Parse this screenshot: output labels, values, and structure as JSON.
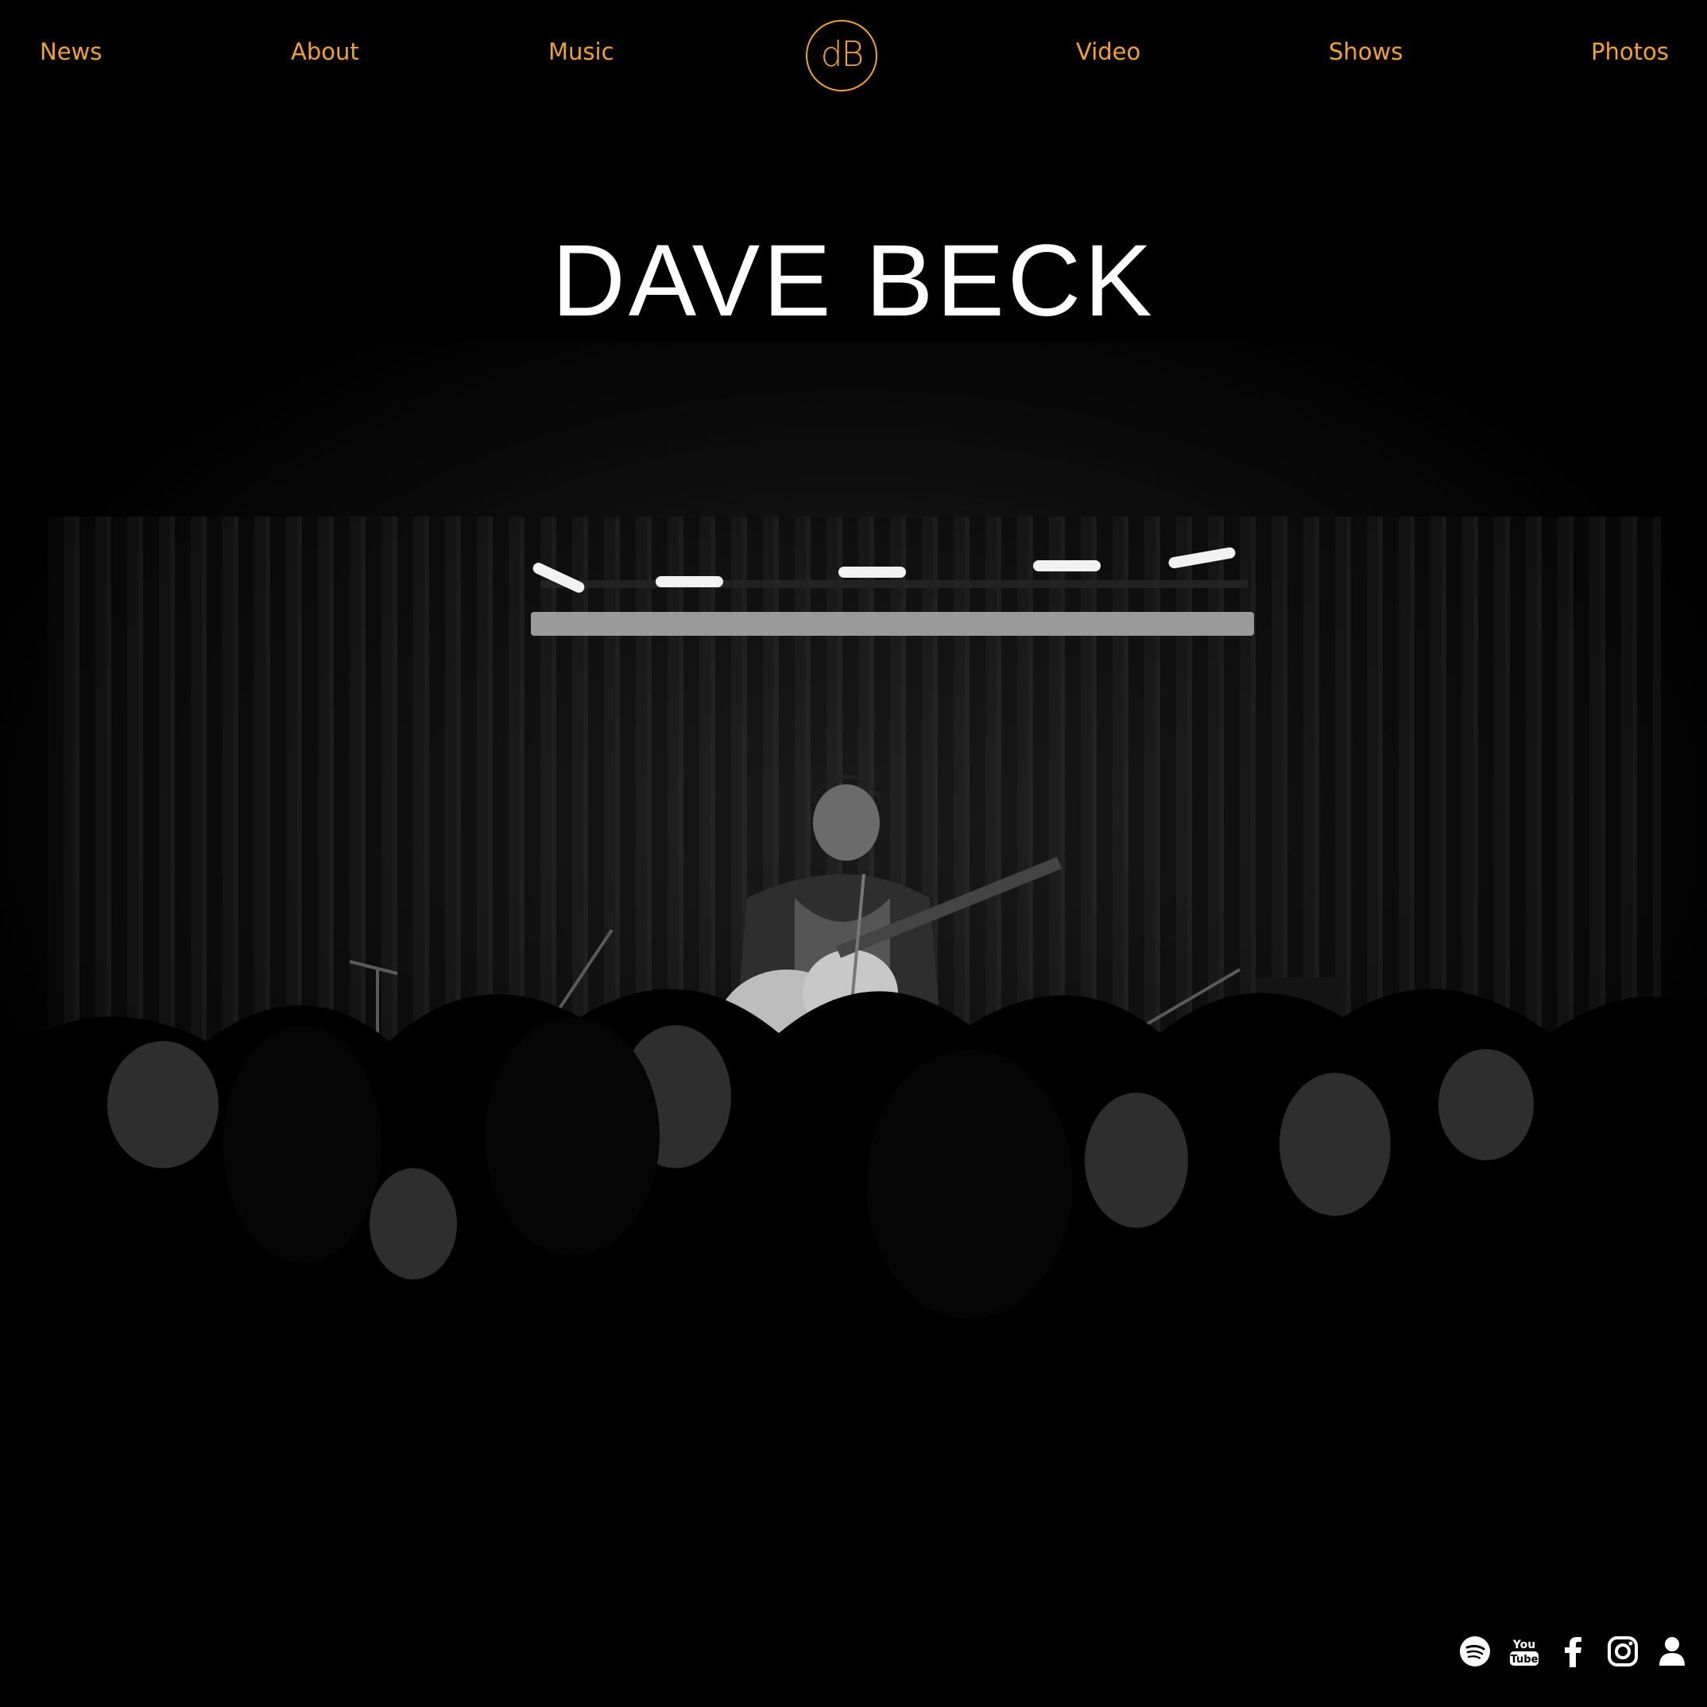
{
  "nav": {
    "items": [
      {
        "label": "News"
      },
      {
        "label": "About"
      },
      {
        "label": "Music"
      },
      {
        "label": "Video"
      },
      {
        "label": "Shows"
      },
      {
        "label": "Photos"
      }
    ],
    "logo_text": "dB"
  },
  "hero": {
    "title": "DAVE BECK",
    "image_description": "Black and white photo of a guitarist performing on stage in front of an audience"
  },
  "social": {
    "icons": [
      "spotify-icon",
      "youtube-icon",
      "facebook-icon",
      "instagram-icon",
      "user-icon"
    ]
  },
  "colors": {
    "accent": "#f2a12b",
    "background": "#000000",
    "title": "#ffffff"
  }
}
